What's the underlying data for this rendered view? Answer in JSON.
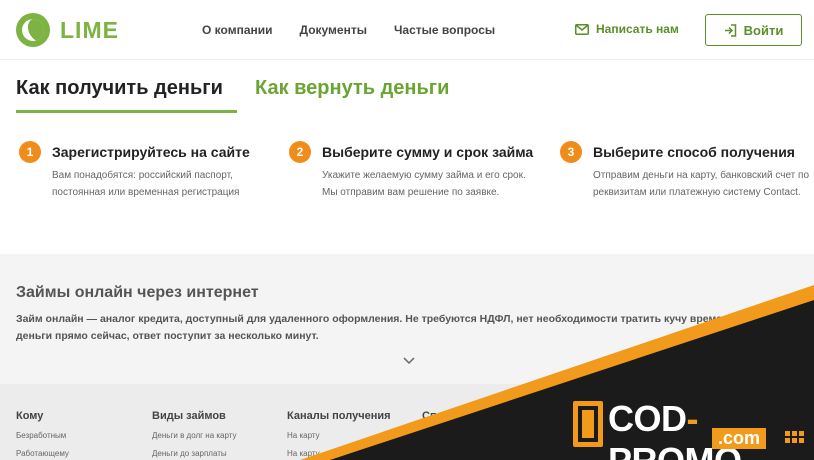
{
  "header": {
    "logo_text": "LIME",
    "nav": [
      "О компании",
      "Документы",
      "Частые вопросы"
    ],
    "write_us": "Написать нам",
    "login": "Войти"
  },
  "tabs": {
    "get": "Как получить деньги",
    "return": "Как вернуть деньги"
  },
  "steps": [
    {
      "num": "1",
      "title": "Зарегистрируйтесь на сайте",
      "desc": "Вам понадобятся: российский паспорт, постоянная или временная регистрация"
    },
    {
      "num": "2",
      "title": "Выберите сумму и срок займа",
      "desc": "Укажите желаемую сумму займа и его срок. Мы отправим вам решение по заявке."
    },
    {
      "num": "3",
      "title": "Выберите способ получения",
      "desc": "Отправим деньги на карту, банковский счет по реквизитам или платежную систему Contact."
    }
  ],
  "info": {
    "title": "Займы онлайн через интернет",
    "line1": "Займ онлайн — аналог кредита, доступный для удаленного оформления. Не требуются НДФЛ, нет необходимости тратить кучу време",
    "line2": "деньги прямо сейчас, ответ поступит за несколько минут."
  },
  "footer": {
    "columns": [
      {
        "title": "Кому",
        "items": [
          "Безработным",
          "Работающему"
        ]
      },
      {
        "title": "Виды займов",
        "items": [
          "Деньги в долг на карту",
          "Деньги до зарплаты"
        ]
      },
      {
        "title": "Каналы получения",
        "items": [
          "На карту",
          "На карту"
        ]
      },
      {
        "title": "Сп",
        "items": []
      }
    ]
  },
  "promo": {
    "main_left": "COD",
    "dash": "-",
    "main_right": "PROMO",
    "sub": ".com"
  },
  "colors": {
    "brand_green": "#7cb342",
    "accent_orange": "#f08c1a",
    "promo_band": "#f29a1c"
  }
}
